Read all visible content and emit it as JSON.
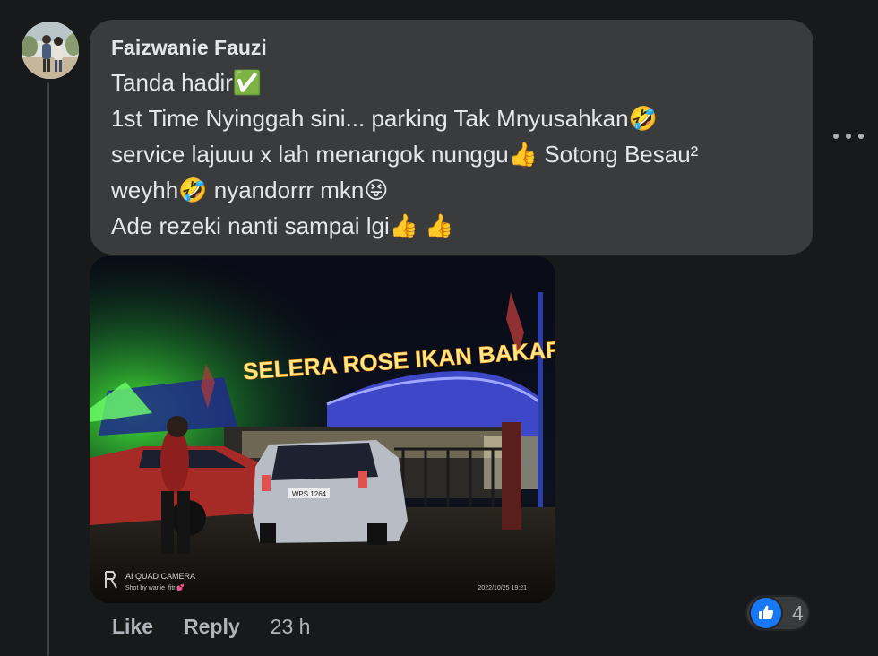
{
  "comment": {
    "author": "Faizwanie Fauzi",
    "lines": [
      "Tanda hadir✅",
      "1st Time Nyinggah sini... parking Tak Mnyusahkan🤣",
      "service lajuuu x lah menangok nunggu👍 Sotong Besau²",
      "weyhh🤣 nyandorrr mkn😝",
      "Ade rezeki nanti sampai lgi👍 👍"
    ]
  },
  "photo": {
    "sign_text": "SELERA ROSE IKAN BAKAR",
    "plate": "WPS 1264",
    "watermark_camera": "AI QUAD CAMERA",
    "watermark_credit": "Shot by wanie_fitri💕",
    "timestamp": "2022/10/25 19:21"
  },
  "actions": {
    "like_label": "Like",
    "reply_label": "Reply",
    "time": "23 h"
  },
  "reactions": {
    "count": "4",
    "icon": "thumbs-up-icon",
    "color": "#1877f2"
  },
  "more_icon": "more-options-icon"
}
